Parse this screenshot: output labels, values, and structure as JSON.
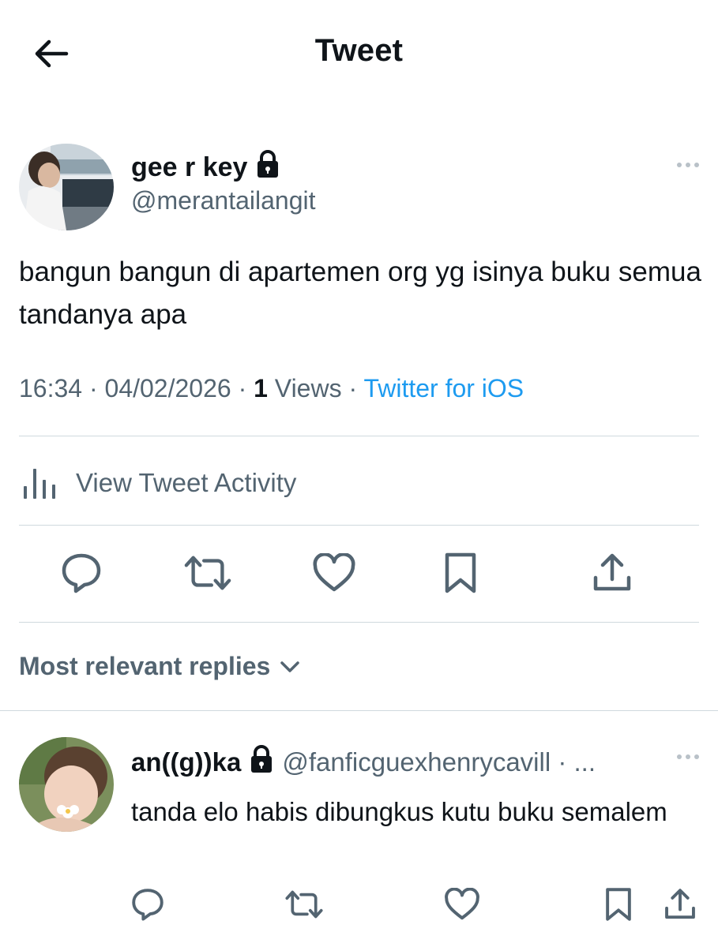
{
  "header": {
    "title": "Tweet"
  },
  "tweet": {
    "author_name": "gee r key",
    "author_handle": "@merantailangit",
    "text": "bangun bangun di apartemen org yg isinya buku semua tandanya apa",
    "time": "16:34",
    "date": "04/02/2026",
    "views_count": "1",
    "views_label": "Views",
    "source": "Twitter for iOS",
    "separator": "·"
  },
  "activity": {
    "label": "View Tweet Activity"
  },
  "actions": {
    "icons": [
      "reply-icon",
      "retweet-icon",
      "like-icon",
      "bookmark-icon",
      "share-icon"
    ]
  },
  "replies": {
    "sort_label": "Most relevant replies",
    "items": [
      {
        "name": "an((g))ka",
        "handle": "@fanficguexhenrycavill · ...",
        "text": "tanda elo habis dibungkus kutu buku semalem"
      }
    ]
  },
  "colors": {
    "text_primary": "#0f1419",
    "text_secondary": "#536471",
    "link_blue": "#1d9bf0",
    "divider": "#cfd9de"
  }
}
